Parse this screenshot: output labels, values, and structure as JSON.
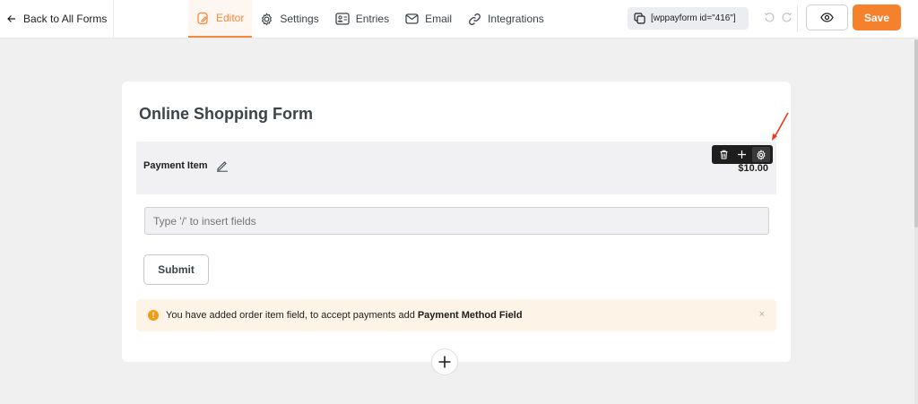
{
  "topbar": {
    "back_label": "Back to All Forms",
    "tabs": [
      {
        "label": "Editor",
        "icon": "editor-icon",
        "active": true
      },
      {
        "label": "Settings",
        "icon": "gear-icon",
        "active": false
      },
      {
        "label": "Entries",
        "icon": "entries-icon",
        "active": false
      },
      {
        "label": "Email",
        "icon": "mail-icon",
        "active": false
      },
      {
        "label": "Integrations",
        "icon": "link-icon",
        "active": false
      }
    ],
    "shortcode": "[wppayform id=\"416\"]",
    "save_label": "Save"
  },
  "form": {
    "title": "Online Shopping Form",
    "payment_item": {
      "label": "Payment Item",
      "price": "$10.00"
    },
    "insert_placeholder": "Type '/' to insert fields",
    "submit_label": "Submit",
    "notice": {
      "text": "You have added order item field, to accept payments add",
      "bold": "Payment Method Field",
      "close": "×"
    }
  },
  "colors": {
    "accent": "#f5812c",
    "active_tab": "#f08a3c",
    "notice_bg": "#fdf3e7",
    "warning": "#f39c12",
    "arrow": "#e8381e"
  }
}
